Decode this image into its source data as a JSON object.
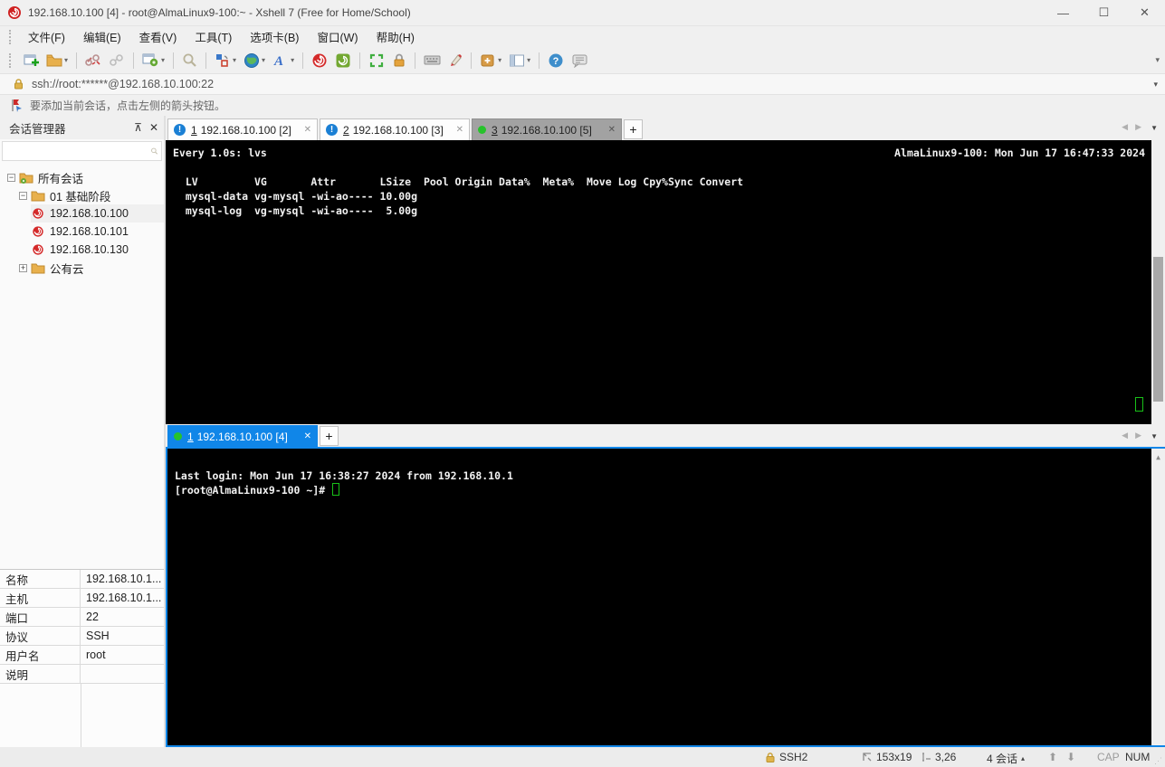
{
  "colors": {
    "accent_blue": "#1086e8",
    "tab_active_grey": "#a2a2a2",
    "terminal_bg": "#000000",
    "terminal_fg": "#f2f2f2",
    "cursor_green": "#18c018",
    "connected_green": "#27c32b",
    "alert_blue": "#1a7fd4"
  },
  "window": {
    "title": "192.168.10.100 [4] - root@AlmaLinux9-100:~ - Xshell 7 (Free for Home/School)",
    "minimize": "—",
    "maximize": "☐",
    "close": "✕"
  },
  "menu": {
    "items": [
      {
        "label": "文件(F)"
      },
      {
        "label": "编辑(E)"
      },
      {
        "label": "查看(V)"
      },
      {
        "label": "工具(T)"
      },
      {
        "label": "选项卡(B)"
      },
      {
        "label": "窗口(W)"
      },
      {
        "label": "帮助(H)"
      }
    ]
  },
  "toolbar": {
    "icons": [
      "new-session",
      "open-sessions",
      "disconnect",
      "reconnect",
      "session-properties",
      "find",
      "compose-pane",
      "encoding-globe",
      "font",
      "xshell",
      "xftp",
      "fullscreen",
      "lock-screen",
      "virtual-keyboard",
      "highlight-pen",
      "new-file",
      "layout",
      "help",
      "feedback-chat"
    ],
    "overflow_caret": "▾"
  },
  "address_bar": {
    "value": "ssh://root:******@192.168.10.100:22",
    "caret": "▾"
  },
  "notice": {
    "text": "要添加当前会话，点击左侧的箭头按钮。"
  },
  "session_manager": {
    "title": "会话管理器",
    "pin": "⊼",
    "close": "✕",
    "search_placeholder": "",
    "tree": {
      "root": {
        "label": "所有会话",
        "expander": "−"
      },
      "folder1": {
        "label": "01 基础阶段",
        "expander": "−"
      },
      "sessions": [
        {
          "label": "192.168.10.100"
        },
        {
          "label": "192.168.10.101"
        },
        {
          "label": "192.168.10.130"
        }
      ],
      "folder2": {
        "label": "公有云",
        "expander": "+"
      }
    },
    "properties": [
      {
        "label": "名称",
        "value": "192.168.10.1..."
      },
      {
        "label": "主机",
        "value": "192.168.10.1..."
      },
      {
        "label": "端口",
        "value": "22"
      },
      {
        "label": "协议",
        "value": "SSH"
      },
      {
        "label": "用户名",
        "value": "root"
      },
      {
        "label": "说明",
        "value": ""
      }
    ]
  },
  "panes": {
    "top": {
      "tabs": [
        {
          "num": "1",
          "label": "192.168.10.100 [2]",
          "status": "alert",
          "close": "✕"
        },
        {
          "num": "2",
          "label": "192.168.10.100 [3]",
          "status": "alert",
          "close": "✕"
        },
        {
          "num": "3",
          "label": "192.168.10.100 [5]",
          "status": "connected",
          "close": "✕"
        }
      ],
      "new_tab": "+",
      "terminal": {
        "header_left": "Every 1.0s: lvs",
        "header_right": "AlmaLinux9-100: Mon Jun 17 16:47:33 2024",
        "lines": [
          "",
          "  LV         VG       Attr       LSize  Pool Origin Data%  Meta%  Move Log Cpy%Sync Convert",
          "  mysql-data vg-mysql -wi-ao---- 10.00g",
          "  mysql-log  vg-mysql -wi-ao----  5.00g"
        ]
      }
    },
    "bottom": {
      "tabs": [
        {
          "num": "1",
          "label": "192.168.10.100 [4]",
          "status": "connected",
          "close": "✕"
        }
      ],
      "new_tab": "+",
      "terminal": {
        "lines": [
          "",
          "Last login: Mon Jun 17 16:38:27 2024 from 192.168.10.1"
        ],
        "prompt": "[root@AlmaLinux9-100 ~]# "
      }
    }
  },
  "status_bar": {
    "protocol": "SSH2",
    "size": "153x19",
    "cursor_pos": "3,26",
    "sessions": "4 会话",
    "sessions_caret": "▴",
    "up": "⬆",
    "down": "⬇",
    "cap": "CAP",
    "num": "NUM"
  }
}
